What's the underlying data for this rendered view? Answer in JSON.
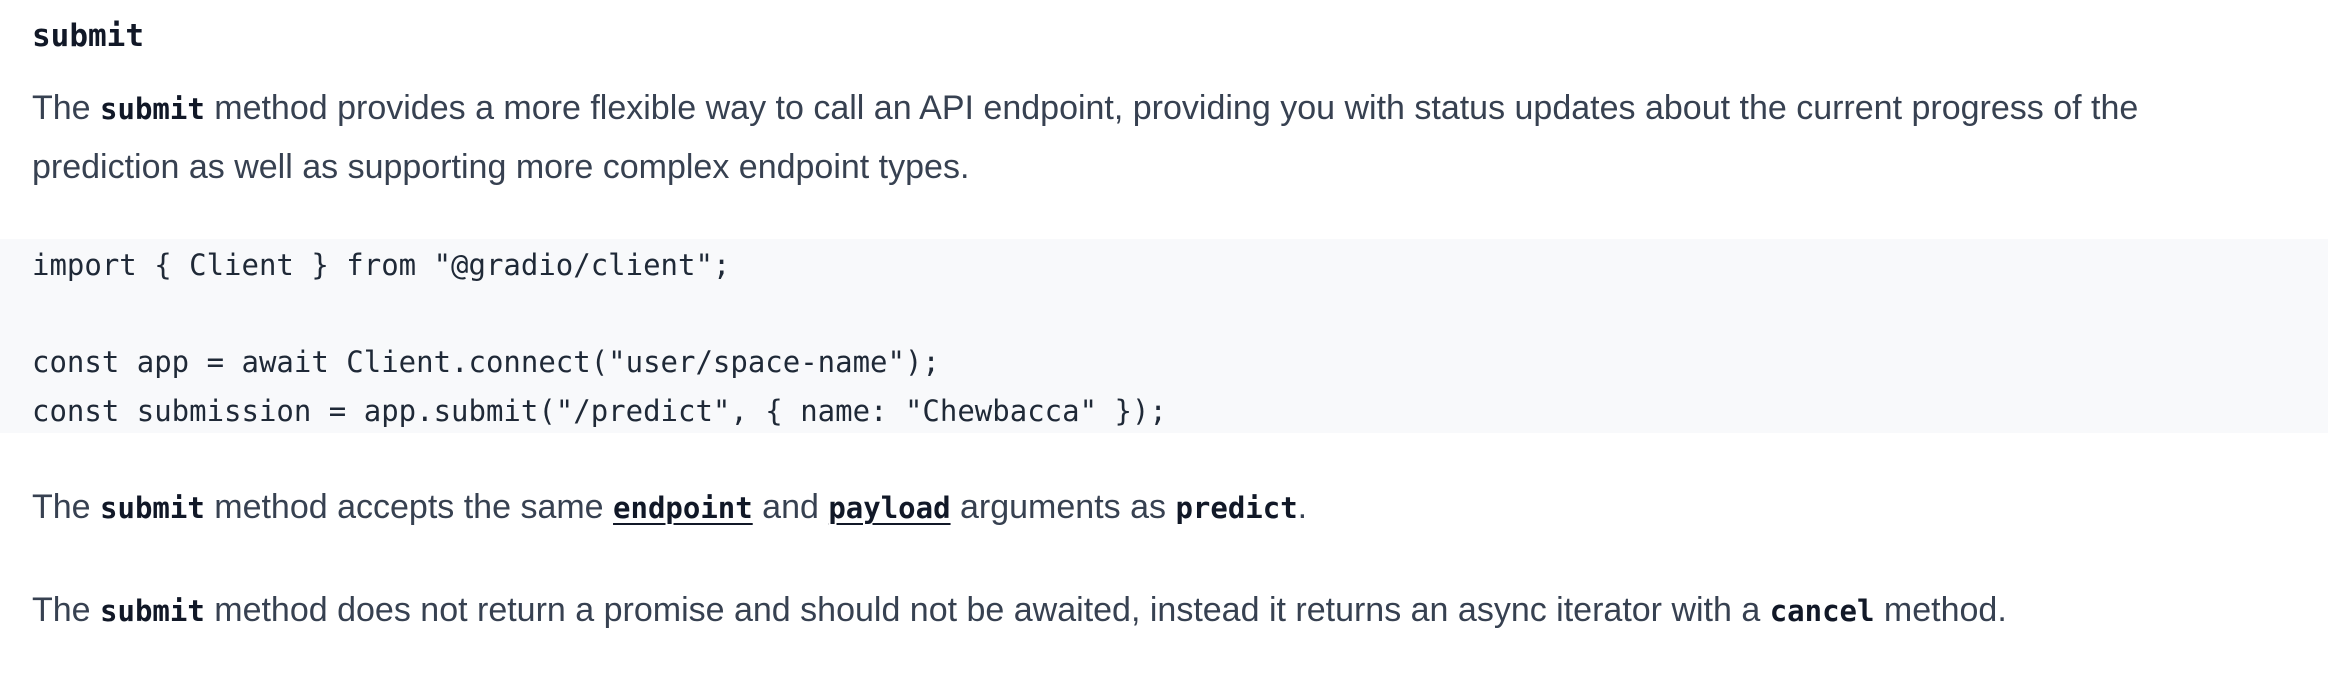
{
  "heading": "submit",
  "intro": {
    "prefix": "The ",
    "code": "submit",
    "suffix": " method provides a more flexible way to call an API endpoint, providing you with status updates about the current progress of the prediction as well as supporting more complex endpoint types."
  },
  "code_block": {
    "lines": [
      "import { Client } from \"@gradio/client\";",
      "",
      "const app = await Client.connect(\"user/space-name\");",
      "const submission = app.submit(\"/predict\", { name: \"Chewbacca\" });"
    ]
  },
  "para2": {
    "t1": "The ",
    "code1": "submit",
    "t2": " method accepts the same ",
    "link1": "endpoint",
    "t3": " and ",
    "link2": "payload",
    "t4": " arguments as ",
    "code2": "predict",
    "t5": "."
  },
  "para3": {
    "t1": "The ",
    "code1": "submit",
    "t2": " method does not return a promise and should not be awaited, instead it returns an async iterator with a ",
    "code2": "cancel",
    "t3": " method."
  }
}
